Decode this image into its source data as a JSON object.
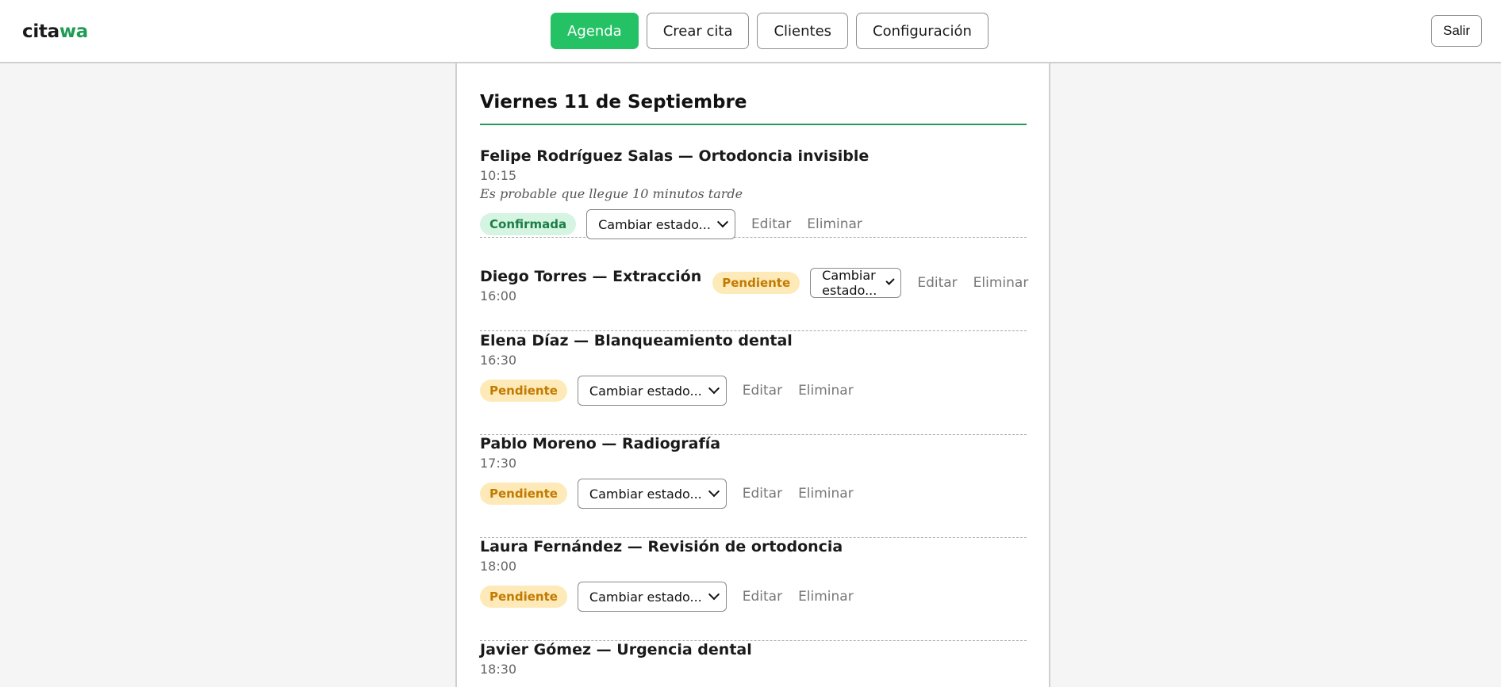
{
  "header": {
    "logo_part1": "cita",
    "logo_part2": "wa",
    "nav": [
      "Agenda",
      "Crear cita",
      "Clientes",
      "Configuración"
    ],
    "logout": "Salir"
  },
  "day": {
    "title": "Viernes 11 de Septiembre"
  },
  "appointments": [
    {
      "title": "Felipe Rodríguez Salas — Ortodoncia invisible",
      "time": "10:15",
      "note": "Es probable que llegue 10 minutos tarde",
      "status": "Confirmada",
      "select": "Cambiar estado...",
      "edit": "Editar",
      "delete": "Eliminar"
    },
    {
      "title": "Diego Torres — Extracción",
      "time": "16:00",
      "status": "Pendiente",
      "select": "Cambiar estado...",
      "edit": "Editar",
      "delete": "Eliminar"
    },
    {
      "title": "Elena Díaz — Blanqueamiento dental",
      "time": "16:30",
      "status": "Pendiente",
      "select": "Cambiar estado...",
      "edit": "Editar",
      "delete": "Eliminar"
    },
    {
      "title": "Pablo Moreno — Radiografía",
      "time": "17:30",
      "status": "Pendiente",
      "select": "Cambiar estado...",
      "edit": "Editar",
      "delete": "Eliminar"
    },
    {
      "title": "Laura Fernández — Revisión de ortodoncia",
      "time": "18:00",
      "status": "Pendiente",
      "select": "Cambiar estado...",
      "edit": "Editar",
      "delete": "Eliminar"
    },
    {
      "title": "Javier Gómez — Urgencia dental",
      "time": "18:30"
    }
  ],
  "colors": {
    "accent": "#25c165",
    "brand_green": "#1f9d55",
    "confirmed_bg": "#d5f4e2",
    "pending_bg": "#fdeab8"
  }
}
